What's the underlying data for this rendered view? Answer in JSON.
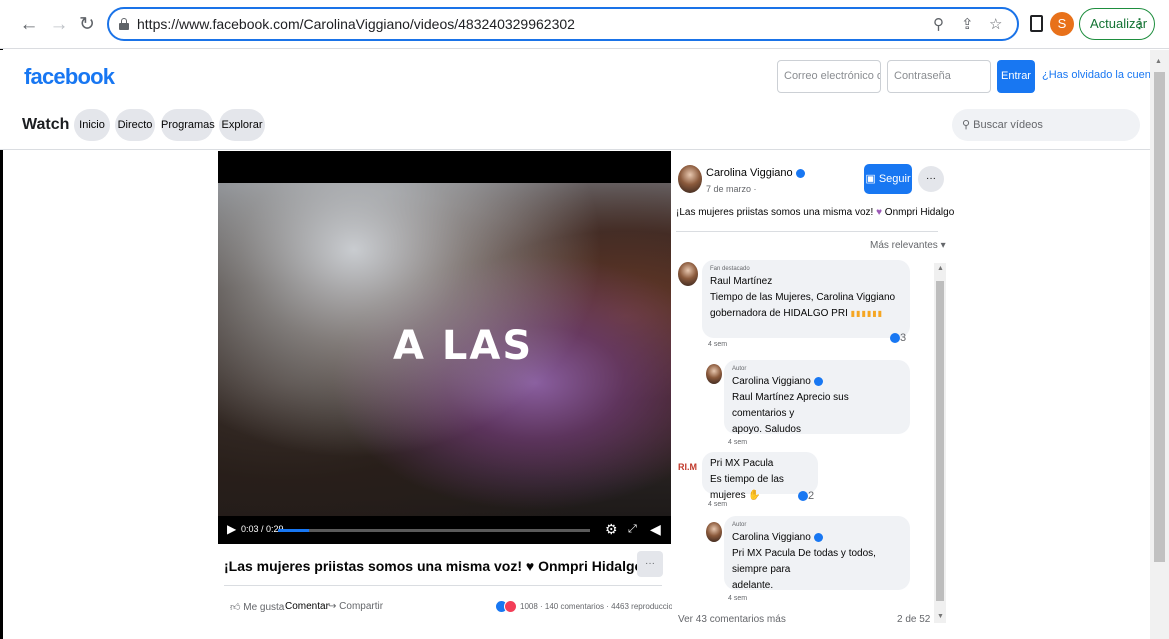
{
  "browser": {
    "url": "https://www.facebook.com/CarolinaViggiano/videos/483240329962302",
    "profile_initial": "S",
    "update_label": "Actualizar"
  },
  "fb": {
    "logo": "facebook",
    "email_placeholder": "Correo electrónico o te",
    "password_placeholder": "Contraseña",
    "enter_label": "Entrar",
    "forgot_label": "¿Has olvidado la cuenta?"
  },
  "watch": {
    "title": "Watch",
    "tabs": [
      "Inicio",
      "Directo",
      "Programas",
      "Explorar"
    ],
    "search_placeholder": "Buscar vídeos"
  },
  "video": {
    "overlay_text": "A LAS",
    "time": "0:03 / 0:29",
    "progress": 0.1,
    "title": "¡Las mujeres priistas somos una misma voz! ♥ Onmpri Hidalgo",
    "actions": {
      "like": "Me gusta",
      "comment": "Comentar",
      "share": "Compartir"
    },
    "stats": "1008 · 140 comentarios · 4463 reproducciones"
  },
  "post": {
    "author": "Carolina Viggiano",
    "date": "7 de marzo ·",
    "follow_label": "Seguir",
    "text": "¡Las mujeres priistas somos una misma voz!",
    "text_suffix": "Onmpri Hidalgo",
    "sort_label": "Más relevantes ▾"
  },
  "comments": [
    {
      "tag": "Fan destacado",
      "name": "Raul Martínez",
      "text_line1": "Tiempo de las Mujeres, Carolina Viggiano",
      "text_line2": "gobernadora de HIDALGO PRI",
      "ago": "4 sem",
      "reactions": "3"
    },
    {
      "tag": "Autor",
      "name": "Carolina Viggiano",
      "text_line1": "Raul Martínez Aprecio sus comentarios y",
      "text_line2": "apoyo. Saludos",
      "ago": "4 sem"
    },
    {
      "avatar_text": "RI.M",
      "name": "Pri MX Pacula",
      "text_line1": "Es tiempo de las mujeres",
      "ago": "4 sem",
      "reactions": "2"
    },
    {
      "tag": "Autor",
      "name": "Carolina Viggiano",
      "text_line1": "Pri MX Pacula De todas y todos, siempre para",
      "text_line2": "adelante.",
      "ago": "4 sem"
    }
  ],
  "footer": {
    "more_comments": "Ver 43 comentarios más",
    "count": "2 de 52"
  },
  "colors": {
    "brand": "#1877f2",
    "heart": "#9b59b6",
    "update_green": "#137333",
    "profile": "#e8711a"
  }
}
